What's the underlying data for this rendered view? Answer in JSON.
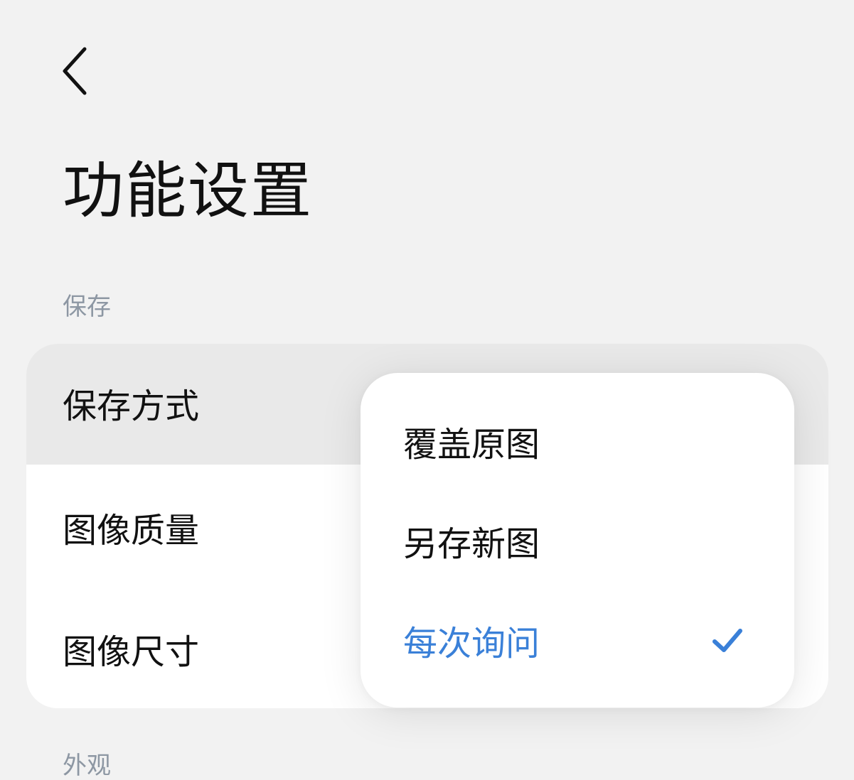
{
  "header": {
    "back_icon": "chevron-left-icon",
    "title": "功能设置"
  },
  "sections": {
    "save": {
      "label": "保存",
      "rows": [
        {
          "label": "保存方式"
        },
        {
          "label": "图像质量"
        },
        {
          "label": "图像尺寸"
        }
      ]
    },
    "appearance": {
      "label": "外观"
    }
  },
  "dropdown": {
    "options": [
      {
        "label": "覆盖原图",
        "selected": false
      },
      {
        "label": "另存新图",
        "selected": false
      },
      {
        "label": "每次询问",
        "selected": true
      }
    ],
    "selected_icon": "checkmark-icon",
    "accent_color": "#3a80d8"
  }
}
